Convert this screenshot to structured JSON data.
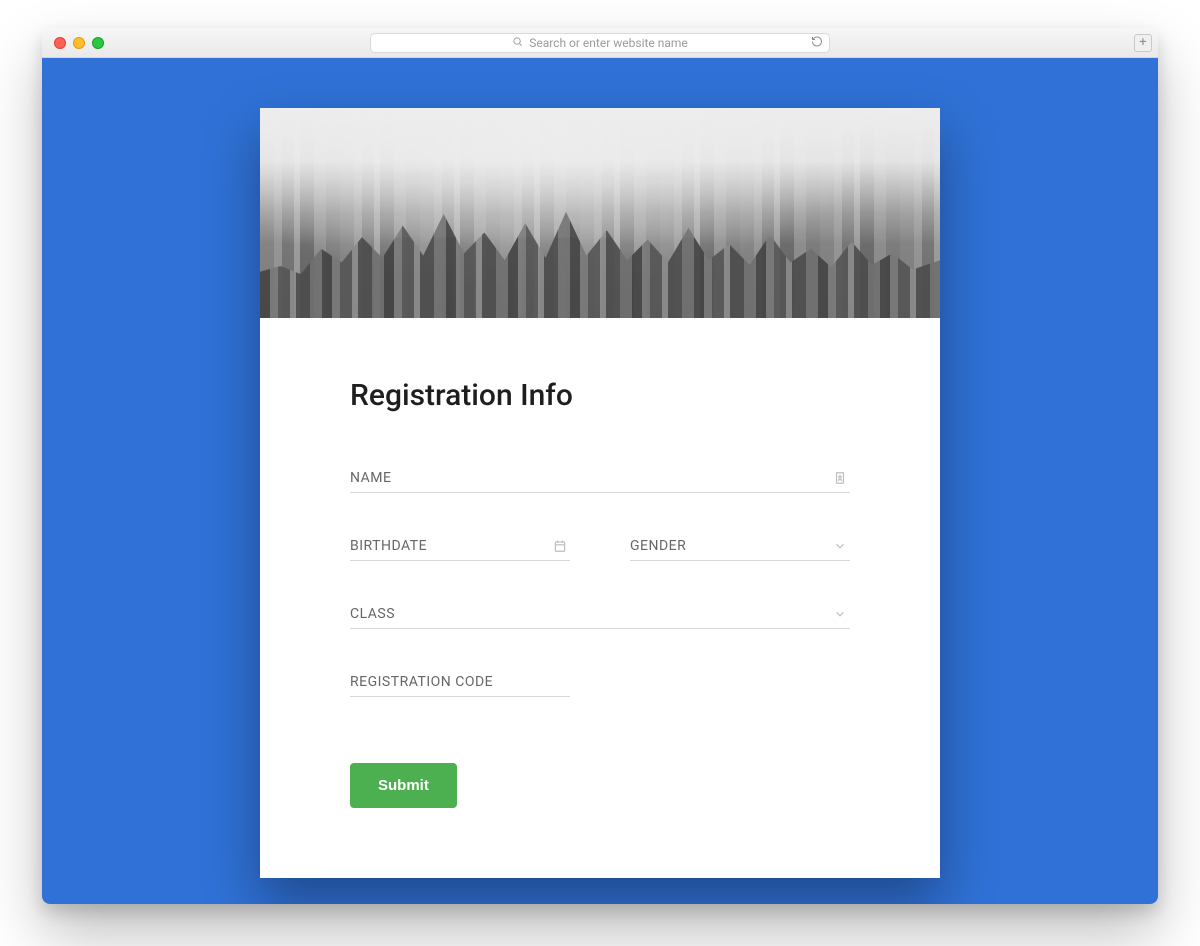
{
  "browser": {
    "address_placeholder": "Search or enter website name"
  },
  "page": {
    "background": "#2f71d6"
  },
  "form": {
    "title": "Registration Info",
    "fields": {
      "name": {
        "label": "NAME",
        "value": "",
        "icon": "id-badge"
      },
      "birthdate": {
        "label": "BIRTHDATE",
        "value": "",
        "icon": "calendar"
      },
      "gender": {
        "label": "GENDER",
        "value": "",
        "icon": "chevron-down"
      },
      "class": {
        "label": "CLASS",
        "value": "",
        "icon": "chevron-down"
      },
      "reg_code": {
        "label": "REGISTRATION CODE",
        "value": ""
      }
    },
    "submit_label": "Submit",
    "submit_color": "#4CAF50"
  }
}
